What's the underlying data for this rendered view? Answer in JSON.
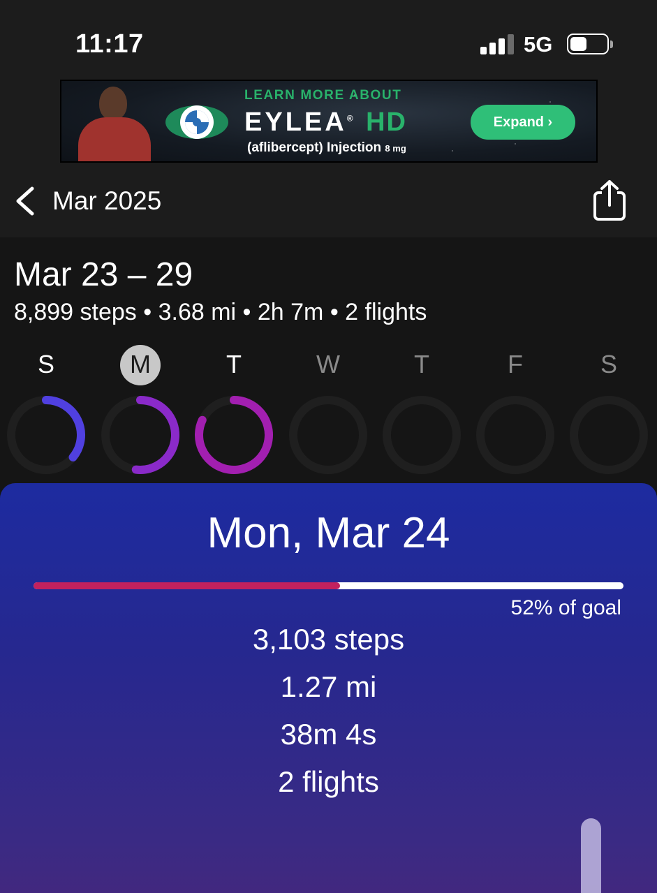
{
  "status_bar": {
    "time": "11:17",
    "network": "5G",
    "signal_bars": 3,
    "signal_bars_total": 4,
    "battery_level": 0.45
  },
  "ad": {
    "learn_more": "LEARN MORE ABOUT",
    "brand": "EYLEA",
    "brand_suffix": "HD",
    "subtitle": "(aflibercept) Injection",
    "dose": "8 mg",
    "button_label": "Expand ›",
    "accent_color": "#29b26b"
  },
  "nav": {
    "back_icon": "chevron-left-icon",
    "title": "Mar 2025",
    "share_icon": "share-icon"
  },
  "week": {
    "title": "Mar 23 – 29",
    "summary": "8,899 steps • 3.68 mi • 2h 7m • 2 flights",
    "days": [
      {
        "letter": "S",
        "state": "past",
        "goal_fraction": 0.36,
        "color": "#5040e0"
      },
      {
        "letter": "M",
        "state": "selected",
        "goal_fraction": 0.52,
        "color": "#8a2ac9"
      },
      {
        "letter": "T",
        "state": "past",
        "goal_fraction": 0.82,
        "color": "#a21fb0"
      },
      {
        "letter": "W",
        "state": "future",
        "goal_fraction": 0,
        "color": "#2a2a2a"
      },
      {
        "letter": "T",
        "state": "future",
        "goal_fraction": 0,
        "color": "#2a2a2a"
      },
      {
        "letter": "F",
        "state": "future",
        "goal_fraction": 0,
        "color": "#2a2a2a"
      },
      {
        "letter": "S",
        "state": "future",
        "goal_fraction": 0,
        "color": "#2a2a2a"
      }
    ]
  },
  "day_detail": {
    "title": "Mon, Mar 24",
    "goal_fraction": 0.52,
    "goal_label": "52% of goal",
    "steps": "3,103 steps",
    "distance": "1.27 mi",
    "duration": "38m 4s",
    "flights": "2 flights",
    "progress_color": "#c2215e"
  }
}
